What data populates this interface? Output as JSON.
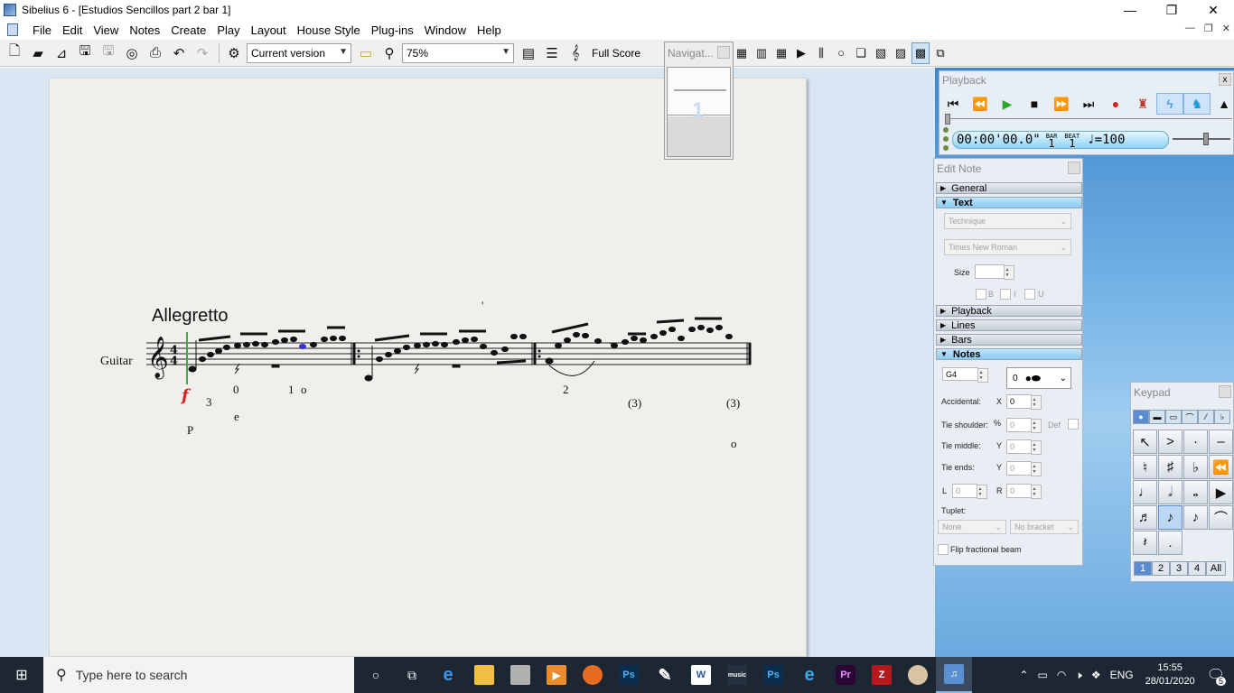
{
  "window": {
    "title": "Sibelius 6 - [Estudios Sencillos part 2 bar 1]",
    "controls": [
      "—",
      "❐",
      "✕"
    ]
  },
  "menu": [
    "File",
    "Edit",
    "View",
    "Notes",
    "Create",
    "Play",
    "Layout",
    "House Style",
    "Plug-ins",
    "Window",
    "Help"
  ],
  "toolbar": {
    "version_value": "Current version",
    "zoom_value": "75%",
    "view_value": "Full Score"
  },
  "navigator": {
    "title": "Navigat...",
    "page_number": "1"
  },
  "score": {
    "tempo": "Allegretto",
    "instrument": "Guitar",
    "dynamic": "f",
    "fingerings": [
      "3",
      "0",
      "1",
      "o",
      "2",
      "(3)",
      "(3)"
    ],
    "lower_text": [
      "e",
      "P",
      "o"
    ],
    "tick_mark": "'"
  },
  "playback": {
    "title": "Playback",
    "close": "x",
    "time": "00:00'00.0\"",
    "bar_label": "BAR",
    "bar": "1",
    "beat_label": "BEAT",
    "beat": "1",
    "tempo": "♩=100"
  },
  "edit_note": {
    "title": "Edit Note",
    "sections": {
      "general": "General",
      "text": "Text",
      "playback": "Playback",
      "lines": "Lines",
      "bars": "Bars",
      "notes": "Notes"
    },
    "text_style": "Technique",
    "font": "Times New Roman",
    "size_label": "Size",
    "bold": "B",
    "italic": "I",
    "underline": "U",
    "pitch": "G4",
    "notehead_value": "0",
    "accidental_label": "Accidental:",
    "accidental_x_label": "X",
    "accidental_x": "0",
    "tie_shoulder_label": "Tie shoulder:",
    "tie_shoulder_pct": "%",
    "tie_shoulder_value": "0",
    "def_label": "Def",
    "tie_middle_label": "Tie middle:",
    "tie_middle_y_label": "Y",
    "tie_middle_value": "0",
    "tie_ends_label": "Tie ends:",
    "tie_ends_y_label": "Y",
    "tie_ends_value": "0",
    "l_label": "L",
    "l_value": "0",
    "r_label": "R",
    "r_value": "0",
    "tuplet_label": "Tuplet:",
    "tuplet_value": "None",
    "bracket_value": "No bracket",
    "flip_label": "Flip fractional beam"
  },
  "keypad": {
    "title": "Keypad",
    "layouts": [
      "1",
      "2",
      "3",
      "4",
      "All"
    ]
  },
  "taskbar": {
    "search_placeholder": "Type here to search",
    "language": "ENG",
    "time": "15:55",
    "date": "28/01/2020",
    "notifications": "5"
  }
}
